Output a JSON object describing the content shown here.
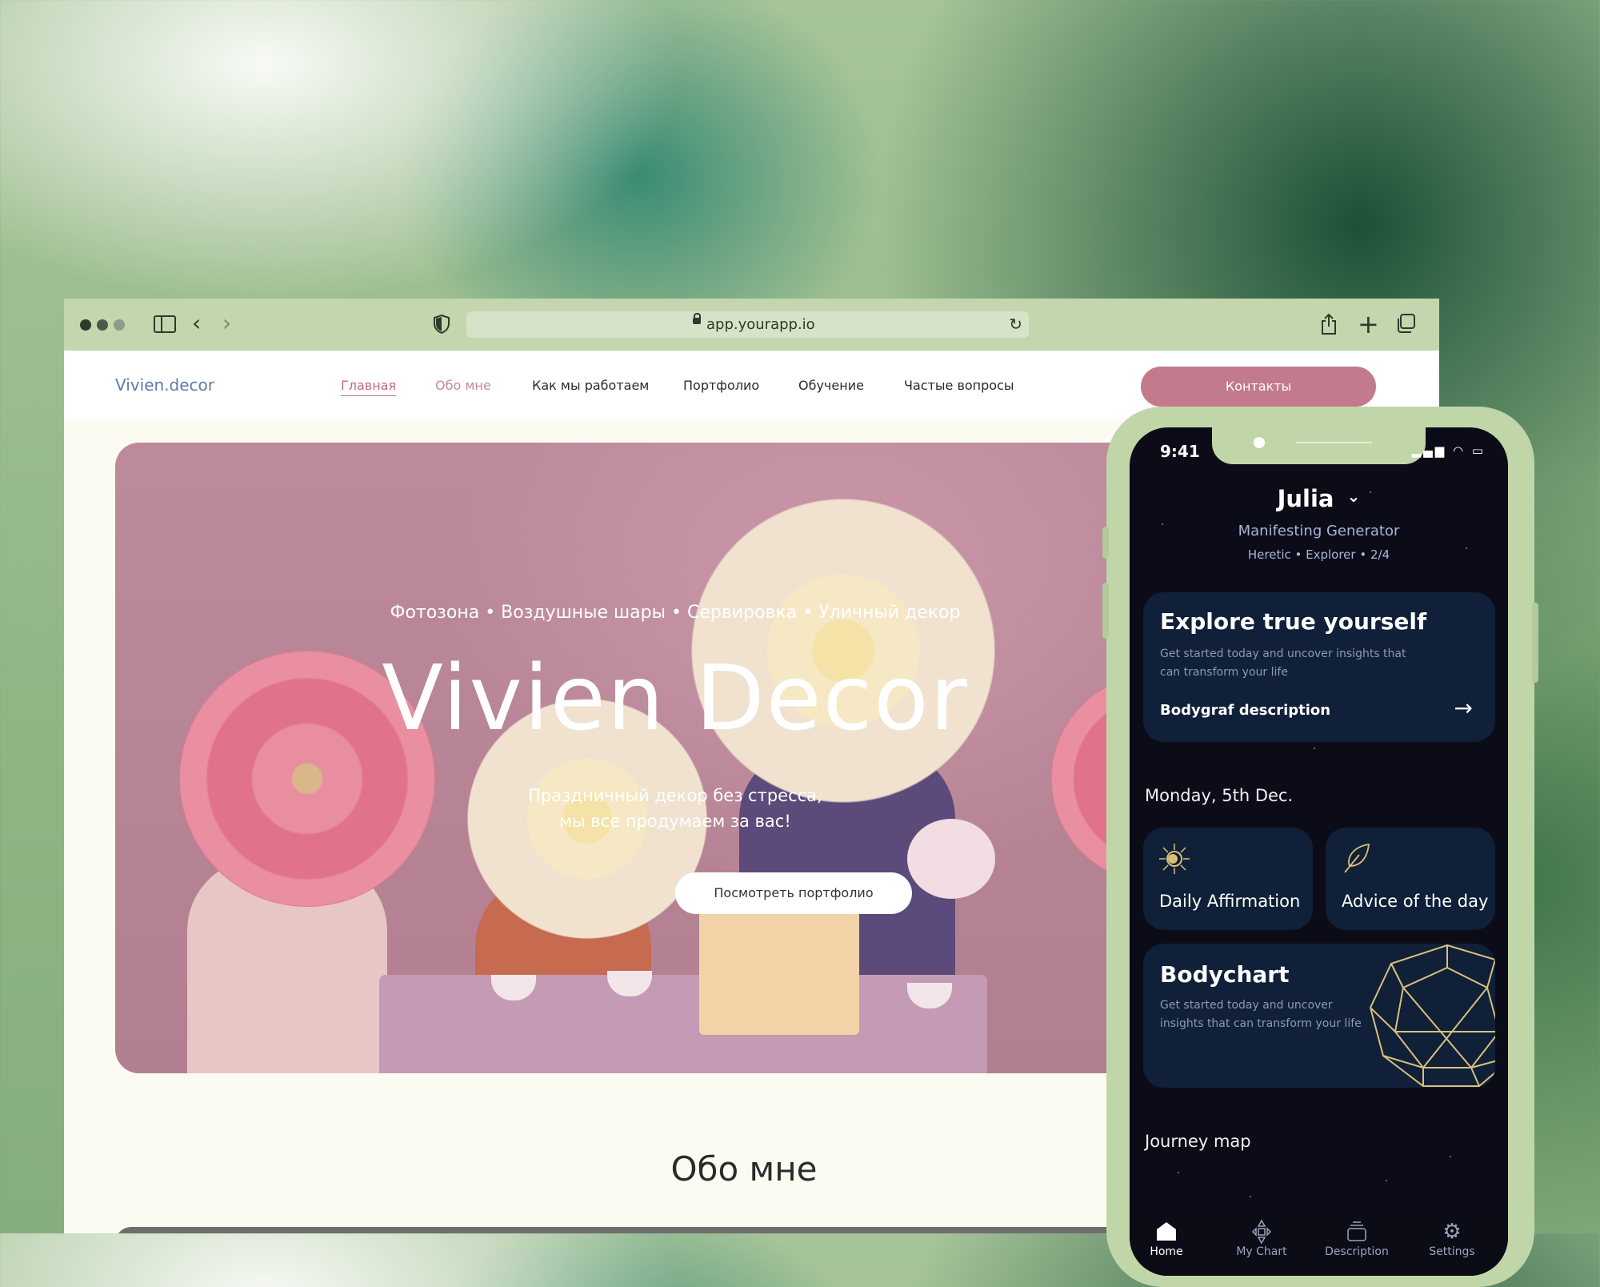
{
  "browser": {
    "url": "app.yourapp.io",
    "icons": [
      "sidebar-icon",
      "back-icon",
      "forward-icon",
      "shield-icon",
      "lock-icon",
      "reload-icon",
      "share-icon",
      "plus-icon",
      "tabs-icon"
    ],
    "colors": {
      "toolbar": "#c3d6ad",
      "urlbar": "#d6e3c8"
    }
  },
  "site": {
    "logo": "Vivien.decor",
    "nav": [
      "Главная",
      "Обо мне",
      "Как мы работаем",
      "Портфолио",
      "Обучение",
      "Частые вопросы"
    ],
    "contact_button": "Контакты",
    "hero": {
      "tags": "Фотозона • Воздушные шары • Сервировка • Уличный декор",
      "title": "Vivien  Decor",
      "subtitle_line1": "Праздничный декор без стресса,",
      "subtitle_line2": "мы все продумаем за вас!",
      "button": "Посмотреть портфолио"
    },
    "about_title": "Обо мне",
    "colors": {
      "accent": "#c27a8c",
      "hero_bg": "#bc8899"
    }
  },
  "phone": {
    "status_time": "9:41",
    "status_icons": "▂▄▆ ◠ ▭",
    "user": {
      "name": "Julia",
      "chevron": "⌄",
      "subtitle": "Manifesting Generator",
      "meta": "Heretic  •  Explorer  •  2/4"
    },
    "explore_card": {
      "title": "Explore true yourself",
      "text_line1": "Get started today and uncover insights that",
      "text_line2": "can transform your life",
      "link": "Bodygraf description",
      "arrow": "→"
    },
    "date": "Monday, 5th Dec.",
    "affirmation_card": {
      "title": "Daily Affirmation",
      "icon": "sun-icon"
    },
    "advice_card": {
      "title": "Advice of the day",
      "icon": "feather-icon"
    },
    "bodychart_card": {
      "title": "Bodychart",
      "text_line1": "Get started today and uncover",
      "text_line2": "insights that can transform your life"
    },
    "journey_label": "Journey map",
    "tabs": [
      {
        "label": "Home",
        "icon": "home-icon"
      },
      {
        "label": "My Chart",
        "icon": "chart-icon"
      },
      {
        "label": "Description",
        "icon": "stack-icon"
      },
      {
        "label": "Settings",
        "icon": "gear-icon"
      }
    ],
    "colors": {
      "frame": "#c1d6a8",
      "screen": "#0b0c18",
      "card": "#0f2038",
      "accent_gold": "#d9c07a"
    }
  }
}
